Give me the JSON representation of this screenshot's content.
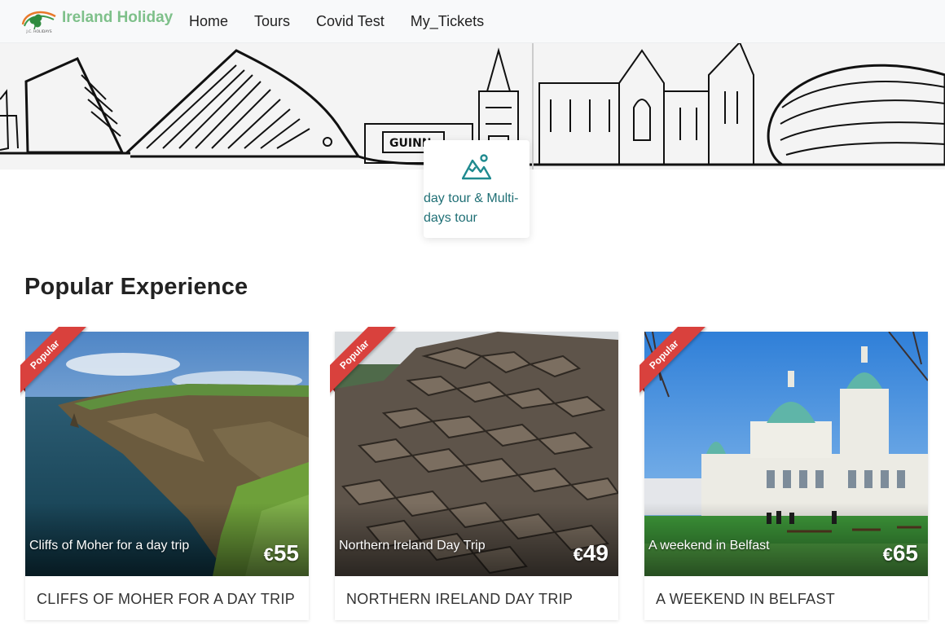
{
  "brand": {
    "name": "Ireland Holiday",
    "logo_text": "J.C. HOLIDAYS"
  },
  "nav": {
    "items": [
      "Home",
      "Tours",
      "Covid Test",
      "My_Tickets"
    ]
  },
  "hero": {
    "sign_text": "GUINN"
  },
  "category": {
    "label": "day tour & Multi-days tour",
    "icon": "mountain-icon"
  },
  "section": {
    "title": "Popular Experience"
  },
  "tours": [
    {
      "caption": "Cliffs of Moher for a day trip",
      "currency": "€",
      "price": "55",
      "title": "CLIFFS OF MOHER FOR A DAY TRIP",
      "badge": "Popular"
    },
    {
      "caption": "Northern Ireland Day Trip",
      "currency": "€",
      "price": "49",
      "title": "NORTHERN IRELAND DAY TRIP",
      "badge": "Popular"
    },
    {
      "caption": "A weekend in Belfast",
      "currency": "€",
      "price": "65",
      "title": "A WEEKEND IN BELFAST",
      "badge": "Popular"
    }
  ],
  "colors": {
    "brand_green": "#7ec08a",
    "teal": "#1f6f75",
    "ribbon_red": "#d9413d"
  }
}
